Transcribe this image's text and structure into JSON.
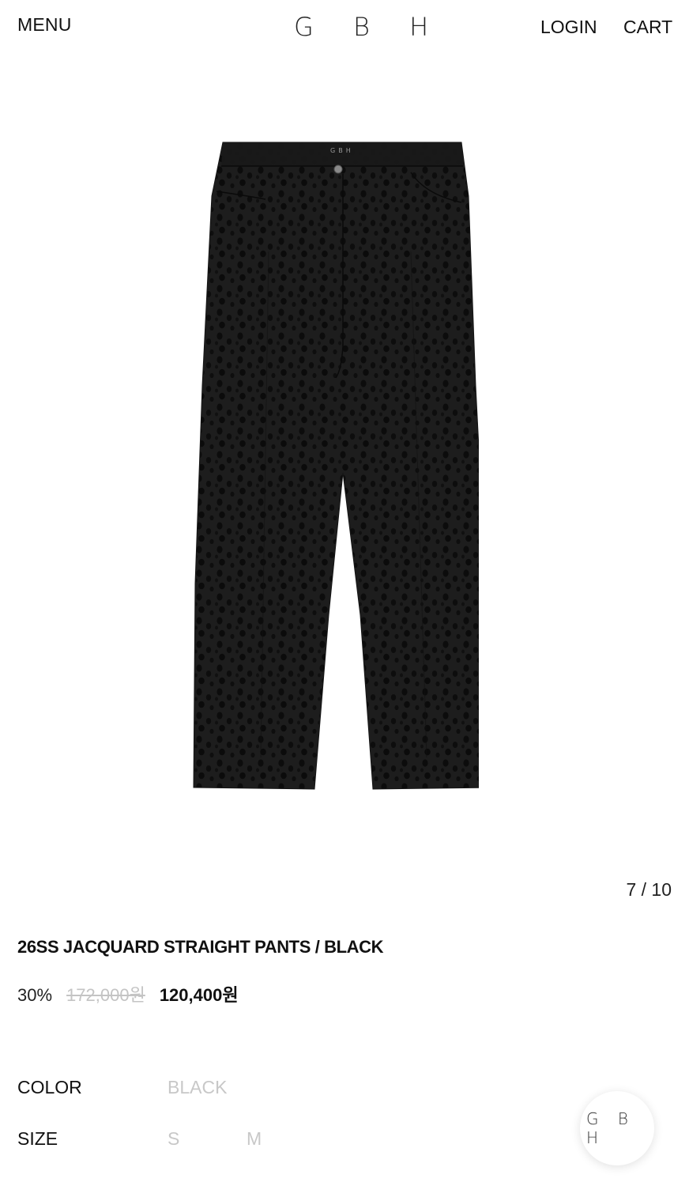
{
  "header": {
    "menu_label": "MENU",
    "logo_text": "G B H",
    "login_label": "LOGIN",
    "cart_label": "CART"
  },
  "gallery": {
    "counter": "7 / 10",
    "image_icon": "product-photo-black-pants",
    "waistband_label": "GBH",
    "background_color": "#f6f6f6"
  },
  "product": {
    "title": "26SS JACQUARD STRAIGHT PANTS / BLACK",
    "discount": "30%",
    "original_price": "172,000원",
    "sale_price": "120,400원"
  },
  "options": {
    "color_label": "COLOR",
    "color_values": [
      "BLACK"
    ],
    "size_label": "SIZE",
    "size_values": [
      "S",
      "M"
    ]
  },
  "floating_button": {
    "label": "G B H"
  }
}
